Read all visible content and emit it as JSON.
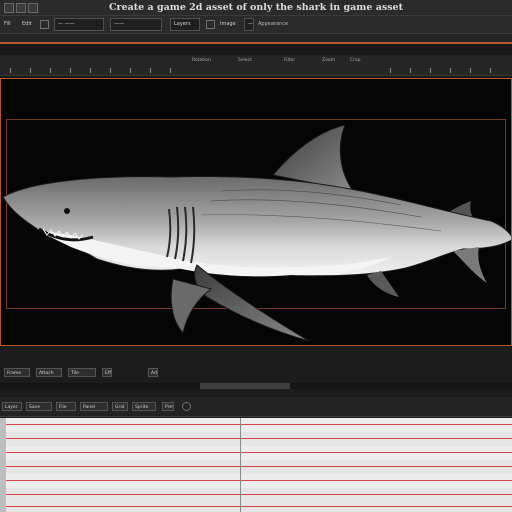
{
  "window": {
    "title": "Create a game 2d asset of only the shark in game asset"
  },
  "menu": {
    "items": [
      "Fill",
      "Edit",
      "Image"
    ],
    "field_1": "— ——",
    "field_2": "——",
    "field_3": "Layers",
    "field_4": "——",
    "right_label": "Appearance"
  },
  "toolbar2": {
    "labels": [
      "Rotation",
      "Select",
      "Filter",
      "Zoom",
      "Crop"
    ]
  },
  "controls": {
    "row1": [
      "Frame",
      "Attach",
      "Tile",
      "Effect",
      "Add"
    ],
    "row2": [
      "Layer",
      "Save",
      "File",
      "Panel",
      "Grid",
      "Sprite",
      "Preview"
    ]
  },
  "colors": {
    "accent": "#b45a2a",
    "track_line": "#d64545",
    "viewport_bg": "#050505"
  }
}
